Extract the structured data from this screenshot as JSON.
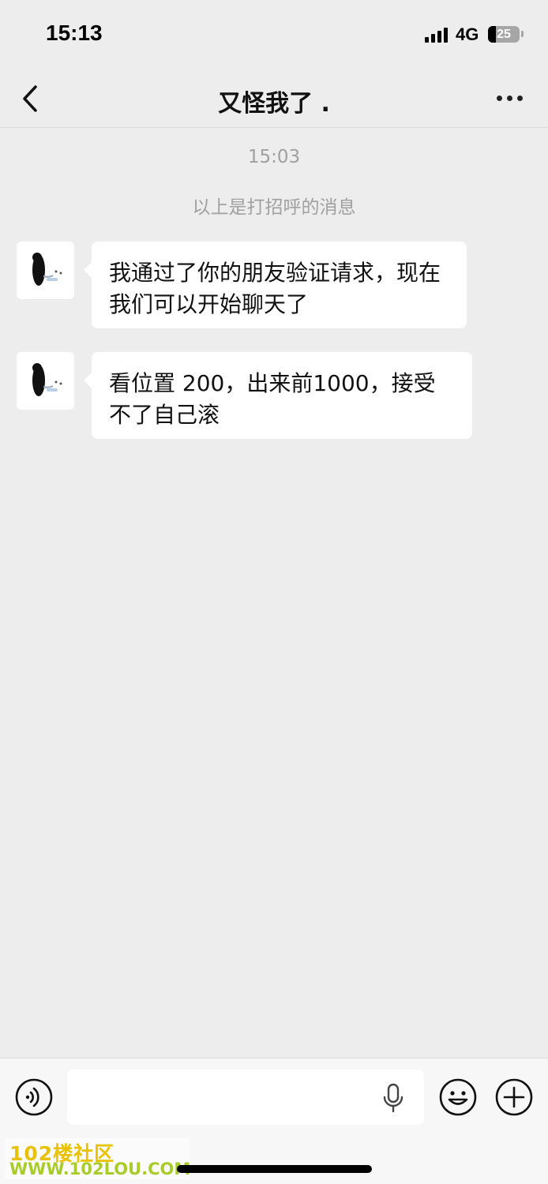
{
  "status_bar": {
    "time": "15:13",
    "network": "4G",
    "battery_level": "25",
    "battery_fraction": 0.25
  },
  "nav": {
    "title": "又怪我了 ."
  },
  "chat": {
    "time_label": "15:03",
    "system_note": "以上是打招呼的消息",
    "messages": [
      {
        "text": "我通过了你的朋友验证请求，现在我们可以开始聊天了"
      },
      {
        "text": "看位置 200，出来前1000，接受不了自己滚"
      }
    ]
  },
  "input_bar": {
    "placeholder": ""
  },
  "watermark": {
    "line1": "102楼社区",
    "line2": "WWW.102LOU.COM"
  },
  "colors": {
    "background": "#ededed",
    "bubble": "#ffffff",
    "timestamp": "#a0a0a0"
  }
}
